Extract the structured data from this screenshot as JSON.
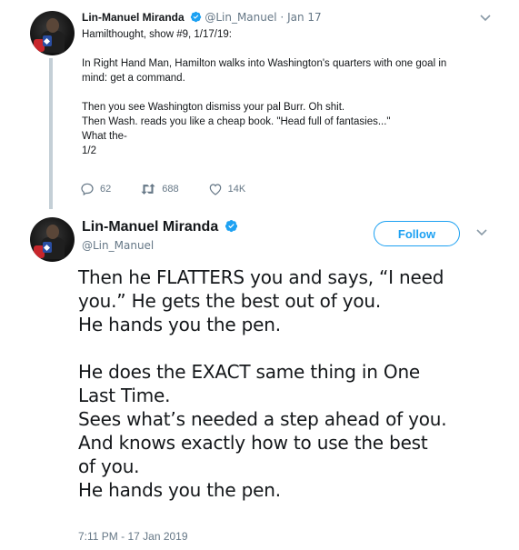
{
  "tweet1": {
    "author_name": "Lin-Manuel Miranda",
    "handle": "@Lin_Manuel",
    "separator": "·",
    "date": "Jan 17",
    "paragraphs": [
      "Hamilthought, show #9, 1/17/19:",
      "",
      "In Right Hand Man, Hamilton walks into Washington's quarters with one goal in\nmind: get a command.",
      "",
      "Then you see Washington dismiss your pal Burr. Oh shit.\nThen Wash. reads you like a cheap book. \"Head full of fantasies...\"\nWhat the-\n1/2"
    ],
    "replies": "62",
    "retweets": "688",
    "likes": "14K"
  },
  "tweet2": {
    "author_name": "Lin-Manuel Miranda",
    "handle": "@Lin_Manuel",
    "follow_label": "Follow",
    "paragraphs": [
      "Then he FLATTERS you and says, “I need\nyou.” He gets the best out of you.\nHe hands you the pen.",
      "",
      "He does the EXACT same thing in One\nLast Time.\nSees what’s needed a step ahead of you.\nAnd knows exactly how to use the best\nof you.\nHe hands you the pen."
    ],
    "timestamp": "7:11 PM - 17 Jan 2019"
  },
  "colors": {
    "accent": "#1da1f2",
    "muted": "#657786",
    "text": "#14171a",
    "thread_line": "#c4cfd6"
  },
  "icons": [
    "verified-icon",
    "chevron-down-icon",
    "reply-icon",
    "retweet-icon",
    "like-icon"
  ]
}
